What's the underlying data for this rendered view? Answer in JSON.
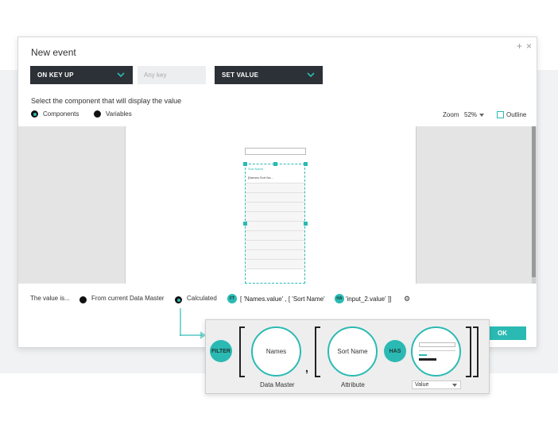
{
  "dialog": {
    "title": "New event",
    "plus_symbol": "+",
    "close_symbol": "×"
  },
  "toolbar": {
    "event_label": "ON KEY UP",
    "key_placeholder": "Any key",
    "action_label": "SET VALUE"
  },
  "select_instruction": "Select the component that will display the value",
  "source_options": [
    {
      "label": "Components",
      "selected": true
    },
    {
      "label": "Variables",
      "selected": false
    }
  ],
  "zoom": {
    "label": "Zoom",
    "value": "52%"
  },
  "outline": {
    "label": "Outline",
    "checked": false
  },
  "preview": {
    "list_header": "Sort Name",
    "list_first_cell": "[Names.Sort Na..."
  },
  "value_row": {
    "label": "The value is...",
    "option_data_master": "From current Data Master",
    "option_calculated": "Calculated",
    "token_filter_short": "FT",
    "expr_part1": "[ 'Names.value' ,   [ 'Sort Name'",
    "token_has_short": "HA",
    "expr_part2": "'input_2.value' ]]",
    "gear_symbol": "⚙"
  },
  "ok_button": "OK",
  "formula_panel": {
    "filter_token": "FILTER",
    "has_token": "HAS",
    "slot1": "Names",
    "slot2": "Sort Name",
    "comma": ",",
    "caption1": "Data Master",
    "caption2": "Attribute",
    "value_select": "Value"
  },
  "colors": {
    "accent": "#2bbab3",
    "dark_dropdown": "#2c3137"
  },
  "icons": {
    "chevron": "chevron-down-icon",
    "gear": "gear-icon"
  }
}
